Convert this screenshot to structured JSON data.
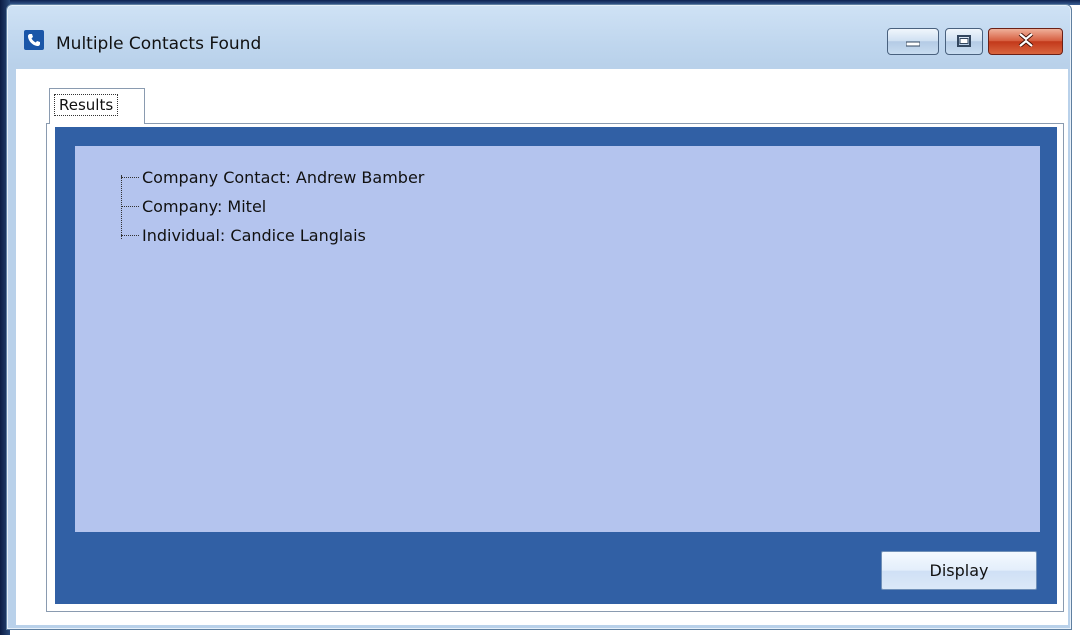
{
  "window": {
    "title": "Multiple Contacts Found",
    "controls": {
      "minimize": "minimize",
      "maximize": "maximize",
      "close": "close"
    }
  },
  "tabs": [
    {
      "label": "Results",
      "selected": true
    }
  ],
  "results": {
    "items": [
      {
        "label": "Company Contact: Andrew Bamber"
      },
      {
        "label": "Company: Mitel"
      },
      {
        "label": "Individual: Candice Langlais"
      }
    ]
  },
  "buttons": {
    "display_label": "Display"
  },
  "colors": {
    "panel": "#3160a5",
    "tree_background": "#b4c4ee",
    "close_button": "#c2381a"
  },
  "icons": {
    "app": "phone-icon",
    "minimize": "minimize-icon",
    "maximize": "maximize-icon",
    "close": "close-icon"
  }
}
